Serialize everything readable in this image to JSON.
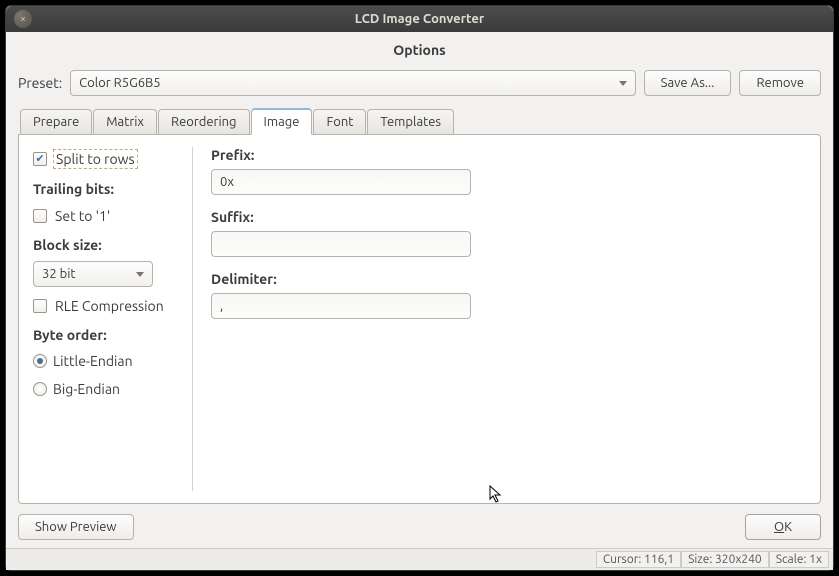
{
  "window": {
    "title": "LCD Image Converter",
    "subtitle": "Options"
  },
  "preset": {
    "label": "Preset:",
    "value": "Color R5G6B5",
    "save_as": "Save As...",
    "remove": "Remove"
  },
  "tabs": [
    "Prepare",
    "Matrix",
    "Reordering",
    "Image",
    "Font",
    "Templates"
  ],
  "active_tab_index": 3,
  "left": {
    "split_to_rows": "Split to rows",
    "trailing_bits": "Trailing bits:",
    "set_to_1": "Set to '1'",
    "block_size_label": "Block size:",
    "block_size_value": "32 bit",
    "rle": "RLE Compression",
    "byte_order": "Byte order:",
    "little_endian": "Little-Endian",
    "big_endian": "Big-Endian"
  },
  "right": {
    "prefix_label": "Prefix:",
    "prefix_value": "0x",
    "suffix_label": "Suffix:",
    "suffix_value": "",
    "delimiter_label": "Delimiter:",
    "delimiter_value": ","
  },
  "buttons": {
    "show_preview": "Show Preview",
    "ok": "OK"
  },
  "status": {
    "cursor": "Cursor: 116,1",
    "size": "Size: 320x240",
    "scale": "Scale: 1x"
  }
}
